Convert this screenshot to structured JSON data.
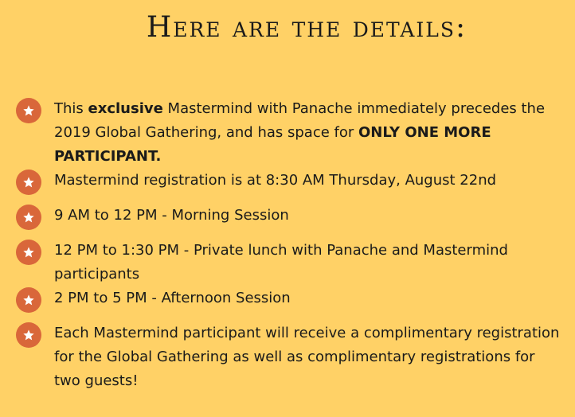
{
  "heading": "Here are the details:",
  "colors": {
    "background": "#FFD166",
    "bullet": "#D9673A",
    "text": "#1a1a1a"
  },
  "bullet_icon": "star-icon",
  "items": [
    {
      "t1": "This ",
      "b1": "exclusive",
      "t2": " Mastermind with Panache immediately precedes the 2019 Global Gathering, and has space for ",
      "b2": "ONLY ONE MORE PARTICIPANT."
    },
    {
      "text": "Mastermind registration is at 8:30 AM Thursday, August 22nd"
    },
    {
      "text": "9 AM to 12 PM - Morning Session"
    },
    {
      "text": "12 PM to 1:30 PM - Private lunch with Panache and Mastermind participants"
    },
    {
      "text": "2 PM to 5 PM - Afternoon Session"
    },
    {
      "text": "Each Mastermind participant will receive a complimentary registration for the Global Gathering as well as complimentary registrations for two guests!"
    }
  ]
}
